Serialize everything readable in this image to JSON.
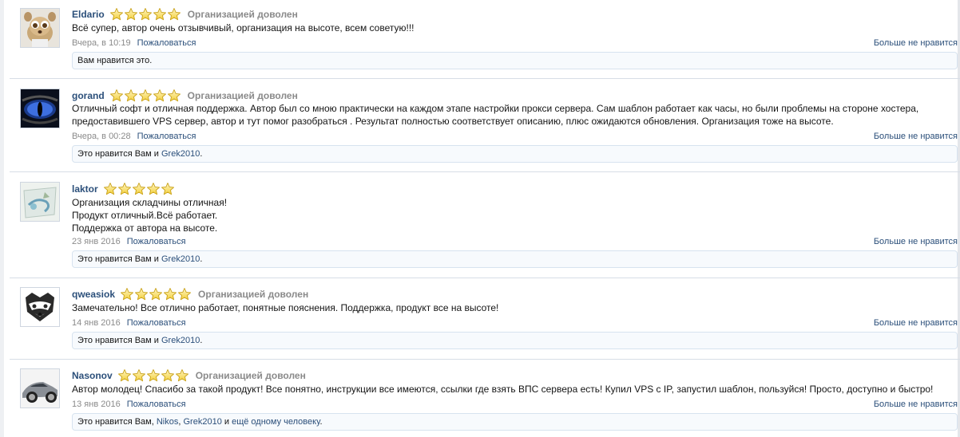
{
  "reviews": [
    {
      "username": "Eldario",
      "rating": 5,
      "verdict": "Организацией доволен",
      "text": [
        "Всё супер, автор очень отзывчивый, организация на высоте, всем советую!!!"
      ],
      "date": "Вчера, в 10:19",
      "report_label": "Пожаловаться",
      "unlike_label": "Больше не нравится",
      "likes": [
        {
          "t": "text",
          "v": "Вам нравится это."
        }
      ],
      "avatar_icon": "lemur-avatar-icon"
    },
    {
      "username": "gorand",
      "rating": 5,
      "verdict": "Организацией доволен",
      "text": [
        "Отличный софт и отличная поддержка. Автор был со мною практически на каждом этапе настройки прокси сервера. Сам шаблон работает как часы, но были проблемы на стороне хостера,",
        "предоставившего VPS сервер, автор и тут помог разобраться . Результат полностью соответствует описанию, плюс ожидаются обновления. Организация тоже на высоте."
      ],
      "date": "Вчера, в 00:28",
      "report_label": "Пожаловаться",
      "unlike_label": "Больше не нравится",
      "likes": [
        {
          "t": "text",
          "v": "Это нравится Вам и "
        },
        {
          "t": "link",
          "v": "Grek2010"
        },
        {
          "t": "text",
          "v": "."
        }
      ],
      "avatar_icon": "dragon-eye-avatar-icon"
    },
    {
      "username": "laktor",
      "rating": 5,
      "verdict": "",
      "text": [
        "Организация складчины отличная!",
        "Продукт отличный.Всё работает.",
        "Поддержка от автора на высоте."
      ],
      "date": "23 янв 2016",
      "report_label": "Пожаловаться",
      "unlike_label": "Больше не нравится",
      "likes": [
        {
          "t": "text",
          "v": "Это нравится Вам и "
        },
        {
          "t": "link",
          "v": "Grek2010"
        },
        {
          "t": "text",
          "v": "."
        }
      ],
      "avatar_icon": "map-avatar-icon"
    },
    {
      "username": "qweasiok",
      "rating": 5,
      "verdict": "Организацией доволен",
      "text": [
        "Замечательно! Все отлично работает, понятные пояснения. Поддержка, продукт все на высоте!"
      ],
      "date": "14 янв 2016",
      "report_label": "Пожаловаться",
      "unlike_label": "Больше не нравится",
      "likes": [
        {
          "t": "text",
          "v": "Это нравится Вам и "
        },
        {
          "t": "link",
          "v": "Grek2010"
        },
        {
          "t": "text",
          "v": "."
        }
      ],
      "avatar_icon": "raccoon-avatar-icon"
    },
    {
      "username": "Nasonov",
      "rating": 5,
      "verdict": "Организацией доволен",
      "text": [
        "Автор молодец! Спасибо за такой продукт! Все понятно, инструкции все имеются, ссылки где взять ВПС сервера есть! Купил VPS с IP, запустил шаблон, пользуйся! Просто, доступно и быстро!"
      ],
      "date": "13 янв 2016",
      "report_label": "Пожаловаться",
      "unlike_label": "Больше не нравится",
      "likes": [
        {
          "t": "text",
          "v": "Это нравится Вам, "
        },
        {
          "t": "link",
          "v": "Nikos"
        },
        {
          "t": "text",
          "v": ", "
        },
        {
          "t": "link",
          "v": "Grek2010"
        },
        {
          "t": "text",
          "v": " и "
        },
        {
          "t": "link",
          "v": "ещё одному человеку"
        },
        {
          "t": "text",
          "v": "."
        }
      ],
      "avatar_icon": "car-avatar-icon"
    }
  ]
}
